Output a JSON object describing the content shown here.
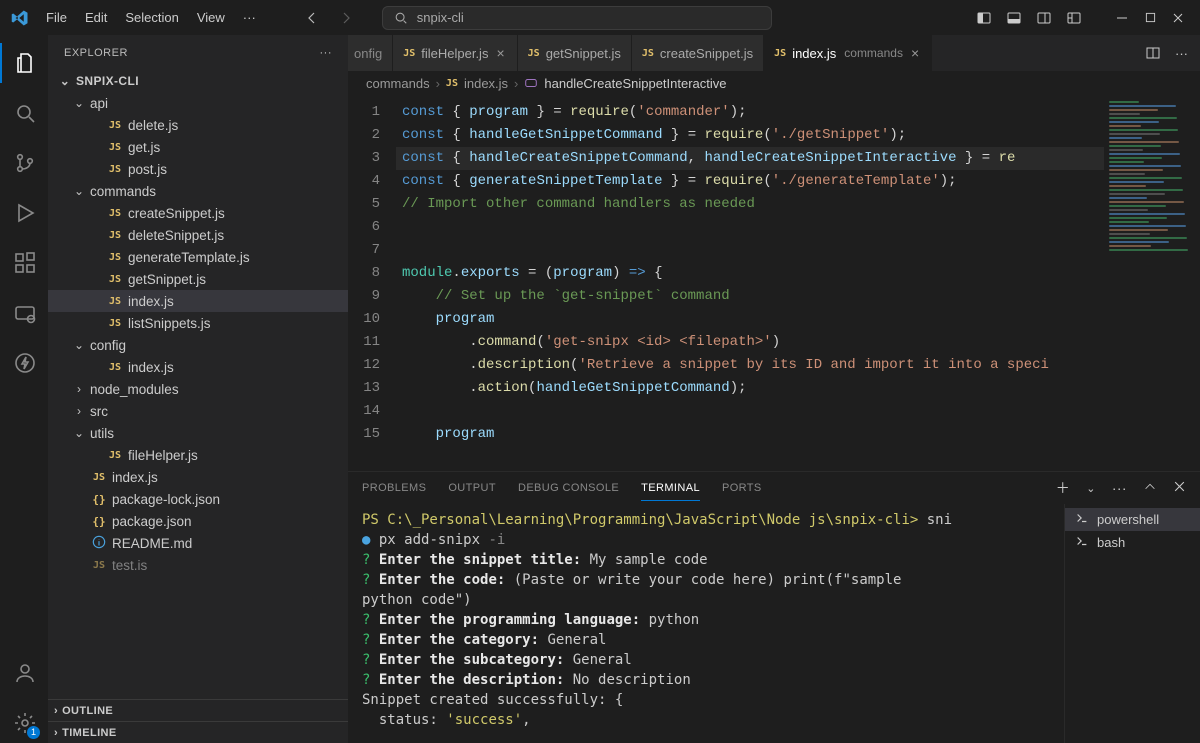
{
  "titlebar": {
    "menus": [
      "File",
      "Edit",
      "Selection",
      "View"
    ],
    "search_text": "snpix-cli"
  },
  "activitybar": {
    "badge": "1"
  },
  "sidebar": {
    "title": "EXPLORER",
    "root": "SNPIX-CLI",
    "tree": [
      {
        "type": "folder",
        "name": "api",
        "open": true,
        "depth": 1
      },
      {
        "type": "file",
        "name": "delete.js",
        "icon": "js",
        "depth": 2
      },
      {
        "type": "file",
        "name": "get.js",
        "icon": "js",
        "depth": 2
      },
      {
        "type": "file",
        "name": "post.js",
        "icon": "js",
        "depth": 2
      },
      {
        "type": "folder",
        "name": "commands",
        "open": true,
        "depth": 1
      },
      {
        "type": "file",
        "name": "createSnippet.js",
        "icon": "js",
        "depth": 2
      },
      {
        "type": "file",
        "name": "deleteSnippet.js",
        "icon": "js",
        "depth": 2
      },
      {
        "type": "file",
        "name": "generateTemplate.js",
        "icon": "js",
        "depth": 2
      },
      {
        "type": "file",
        "name": "getSnippet.js",
        "icon": "js",
        "depth": 2
      },
      {
        "type": "file",
        "name": "index.js",
        "icon": "js",
        "depth": 2,
        "selected": true
      },
      {
        "type": "file",
        "name": "listSnippets.js",
        "icon": "js",
        "depth": 2
      },
      {
        "type": "folder",
        "name": "config",
        "open": true,
        "depth": 1
      },
      {
        "type": "file",
        "name": "index.js",
        "icon": "js",
        "depth": 2
      },
      {
        "type": "folder",
        "name": "node_modules",
        "open": false,
        "depth": 1
      },
      {
        "type": "folder",
        "name": "src",
        "open": false,
        "depth": 1
      },
      {
        "type": "folder",
        "name": "utils",
        "open": true,
        "depth": 1
      },
      {
        "type": "file",
        "name": "fileHelper.js",
        "icon": "js",
        "depth": 2
      },
      {
        "type": "file",
        "name": "index.js",
        "icon": "js",
        "depth": 1
      },
      {
        "type": "file",
        "name": "package-lock.json",
        "icon": "json",
        "depth": 1
      },
      {
        "type": "file",
        "name": "package.json",
        "icon": "json",
        "depth": 1
      },
      {
        "type": "file",
        "name": "README.md",
        "icon": "info",
        "depth": 1
      },
      {
        "type": "file",
        "name": "test.is",
        "icon": "js",
        "depth": 1,
        "dim": true
      }
    ],
    "sections": [
      "OUTLINE",
      "TIMELINE"
    ]
  },
  "tabs": [
    {
      "label": "onfig",
      "icon": "",
      "partial": true
    },
    {
      "label": "fileHelper.js",
      "icon": "js",
      "close": true
    },
    {
      "label": "getSnippet.js",
      "icon": "js"
    },
    {
      "label": "createSnippet.js",
      "icon": "js"
    },
    {
      "label": "index.js",
      "icon": "js",
      "desc": "commands",
      "active": true,
      "close": true
    }
  ],
  "breadcrumbs": {
    "segments": [
      "commands",
      "index.js"
    ],
    "symbol": "handleCreateSnippetInteractive"
  },
  "code": {
    "lines": [
      {
        "n": 1,
        "html": "<span class='kw'>const</span> { <span class='var'>program</span> } <span class='op'>=</span> <span class='fn'>require</span>(<span class='str'>'commander'</span>);"
      },
      {
        "n": 2,
        "html": "<span class='kw'>const</span> { <span class='var'>handleGetSnippetCommand</span> } <span class='op'>=</span> <span class='fn'>require</span>(<span class='str'>'./getSnippet'</span>);"
      },
      {
        "n": 3,
        "hl": true,
        "html": "<span class='kw'>const</span> { <span class='var'>handleCreateSnippetCommand</span>, <span class='var'>handleCreateSnippetInteractive</span> } <span class='op'>=</span> <span class='fn'>re</span>"
      },
      {
        "n": 4,
        "html": "<span class='kw'>const</span> { <span class='var'>generateSnippetTemplate</span> } <span class='op'>=</span> <span class='fn'>require</span>(<span class='str'>'./generateTemplate'</span>);"
      },
      {
        "n": 5,
        "html": "<span class='cmt'>// Import other command handlers as needed</span>"
      },
      {
        "n": 6,
        "html": ""
      },
      {
        "n": 7,
        "html": ""
      },
      {
        "n": 8,
        "html": "<span class='cls'>module</span>.<span class='var'>exports</span> <span class='op'>=</span> (<span class='var'>program</span>) <span class='kw'>=&gt;</span> {"
      },
      {
        "n": 9,
        "html": "    <span class='cmt'>// Set up the `get-snippet` command</span>"
      },
      {
        "n": 10,
        "html": "    <span class='var'>program</span>"
      },
      {
        "n": 11,
        "html": "        .<span class='fn'>command</span>(<span class='str'>'get-snipx &lt;id&gt; &lt;filepath&gt;'</span>)"
      },
      {
        "n": 12,
        "html": "        .<span class='fn'>description</span>(<span class='str'>'Retrieve a snippet by its ID and import it into a speci</span>"
      },
      {
        "n": 13,
        "html": "        .<span class='fn'>action</span>(<span class='var'>handleGetSnippetCommand</span>);"
      },
      {
        "n": 14,
        "html": ""
      },
      {
        "n": 15,
        "html": "    <span class='var'>program</span>"
      }
    ]
  },
  "panel": {
    "tabs": [
      "PROBLEMS",
      "OUTPUT",
      "DEBUG CONSOLE",
      "TERMINAL",
      "PORTS"
    ],
    "active": "TERMINAL",
    "terminal": {
      "prompt": "PS C:\\_Personal\\Learning\\Programming\\JavaScript\\Node js\\snpix-cli>",
      "cmd1": "sni",
      "cmd2": "px add-snipx",
      "flag": "-i",
      "lines": [
        {
          "q": true,
          "label": "Enter the snippet title:",
          "val": "My sample code"
        },
        {
          "q": true,
          "label": "Enter the code:",
          "val": "(Paste or write your code here) print(f\"sample"
        },
        {
          "cont": "python code\")"
        },
        {
          "q": true,
          "label": "Enter the programming language:",
          "val": "python"
        },
        {
          "q": true,
          "label": "Enter the category:",
          "val": "General"
        },
        {
          "q": true,
          "label": "Enter the subcategory:",
          "val": "General"
        },
        {
          "q": true,
          "label": "Enter the description:",
          "val": "No description"
        }
      ],
      "result1": "Snippet created successfully: {",
      "result2": "  status:",
      "result2v": "'success'",
      "tail": ","
    },
    "shells": [
      {
        "name": "powershell",
        "icon": "ps",
        "active": true
      },
      {
        "name": "bash",
        "icon": "bash"
      }
    ]
  }
}
